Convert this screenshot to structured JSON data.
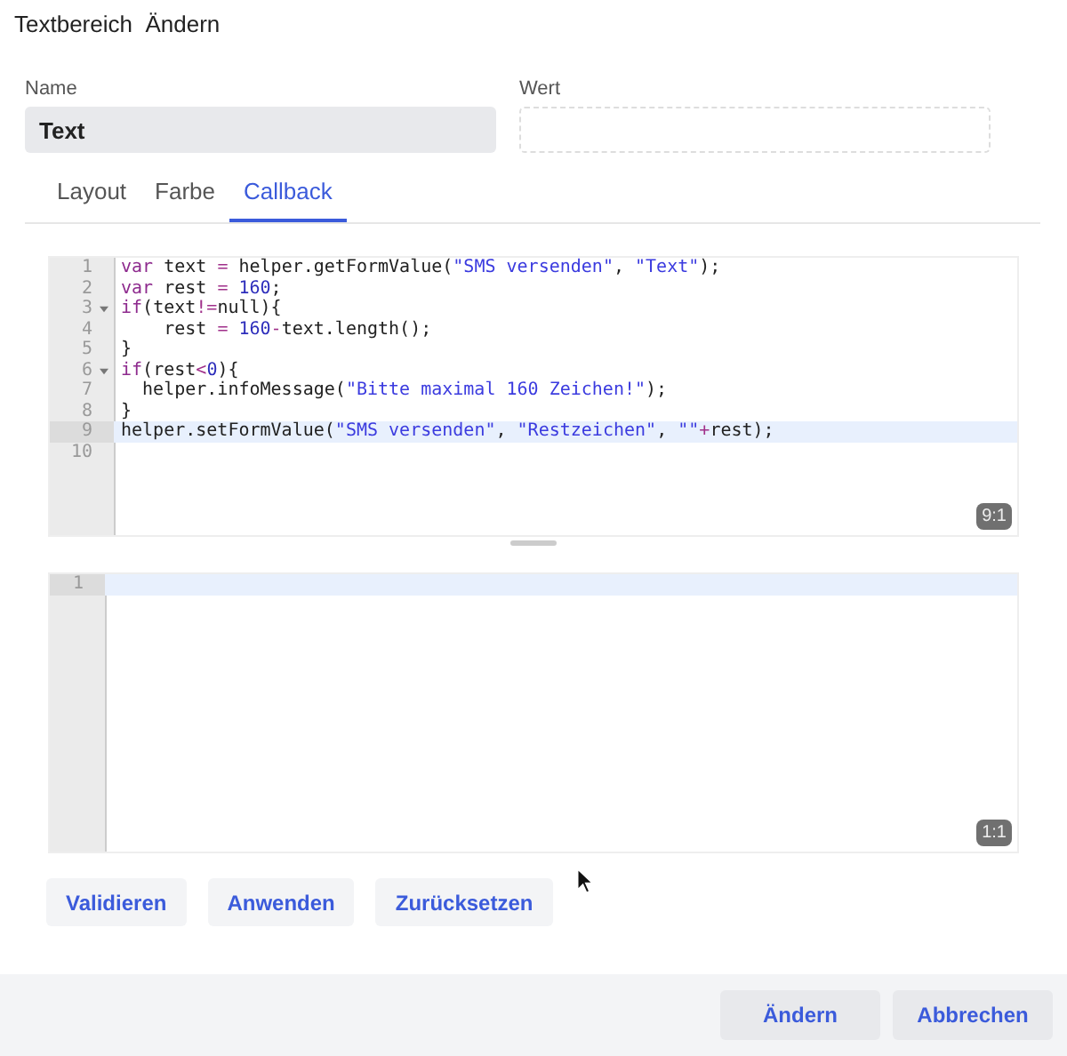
{
  "window": {
    "title": "Textbereich  Ändern"
  },
  "fields": [
    {
      "label": "Name",
      "value": "Text",
      "disabled": true
    },
    {
      "label": "Wert",
      "disabled": false
    }
  ],
  "tabs": [
    {
      "label": "Layout",
      "selected": false
    },
    {
      "label": "Farbe",
      "selected": false
    },
    {
      "label": "Callback",
      "selected": true
    }
  ],
  "code_editor": {
    "cursor_position": "9:1",
    "lines": [
      {
        "number": "1",
        "fold": false,
        "active": false,
        "tokens": [
          {
            "t": "var",
            "kind": "keyword"
          },
          {
            "t": " text ",
            "kind": "plain"
          },
          {
            "t": "=",
            "kind": "operator"
          },
          {
            "t": " helper.getFormValue(",
            "kind": "plain"
          },
          {
            "t": "\"SMS versenden\"",
            "kind": "string"
          },
          {
            "t": ", ",
            "kind": "plain"
          },
          {
            "t": "\"Text\"",
            "kind": "string"
          },
          {
            "t": ");",
            "kind": "plain"
          }
        ]
      },
      {
        "number": "2",
        "fold": false,
        "active": false,
        "tokens": [
          {
            "t": "var",
            "kind": "keyword"
          },
          {
            "t": " rest ",
            "kind": "plain"
          },
          {
            "t": "= ",
            "kind": "operator"
          },
          {
            "t": "160",
            "kind": "number"
          },
          {
            "t": ";",
            "kind": "plain"
          }
        ]
      },
      {
        "number": "3",
        "fold": true,
        "active": false,
        "tokens": [
          {
            "t": "if",
            "kind": "keyword"
          },
          {
            "t": "(text",
            "kind": "plain"
          },
          {
            "t": "!=",
            "kind": "operator"
          },
          {
            "t": "null){",
            "kind": "plain"
          }
        ]
      },
      {
        "number": "4",
        "fold": false,
        "active": false,
        "tokens": [
          {
            "t": "    rest ",
            "kind": "plain"
          },
          {
            "t": "= ",
            "kind": "operator"
          },
          {
            "t": "160",
            "kind": "number"
          },
          {
            "t": "-",
            "kind": "operator"
          },
          {
            "t": "text.length();",
            "kind": "plain"
          }
        ]
      },
      {
        "number": "5",
        "fold": false,
        "active": false,
        "tokens": [
          {
            "t": "}",
            "kind": "plain"
          }
        ]
      },
      {
        "number": "6",
        "fold": true,
        "active": false,
        "tokens": [
          {
            "t": "if",
            "kind": "keyword"
          },
          {
            "t": "(rest",
            "kind": "plain"
          },
          {
            "t": "<",
            "kind": "operator"
          },
          {
            "t": "0",
            "kind": "number"
          },
          {
            "t": "){",
            "kind": "plain"
          }
        ]
      },
      {
        "number": "7",
        "fold": false,
        "active": false,
        "tokens": [
          {
            "t": "  helper.infoMessage(",
            "kind": "plain"
          },
          {
            "t": "\"Bitte maximal 160 Zeichen!\"",
            "kind": "string"
          },
          {
            "t": ");",
            "kind": "plain"
          }
        ]
      },
      {
        "number": "8",
        "fold": false,
        "active": false,
        "tokens": [
          {
            "t": "}",
            "kind": "plain"
          }
        ]
      },
      {
        "number": "9",
        "fold": false,
        "active": true,
        "tokens": [
          {
            "t": "helper.setFormValue(",
            "kind": "plain"
          },
          {
            "t": "\"SMS versenden\"",
            "kind": "string"
          },
          {
            "t": ", ",
            "kind": "plain"
          },
          {
            "t": "\"Restzeichen\"",
            "kind": "string"
          },
          {
            "t": ", ",
            "kind": "plain"
          },
          {
            "t": "\"\"",
            "kind": "string"
          },
          {
            "t": "+",
            "kind": "operator"
          },
          {
            "t": "rest);",
            "kind": "plain"
          }
        ]
      },
      {
        "number": "10",
        "fold": false,
        "active": false
      }
    ]
  },
  "output_editor": {
    "cursor_position": "1:1",
    "lines": [
      {
        "number": "1",
        "fold": false,
        "active": true
      }
    ]
  },
  "actions": [
    "Validieren",
    "Anwenden",
    "Zurücksetzen"
  ],
  "footer_buttons": [
    "Ändern",
    "Abbrechen"
  ]
}
